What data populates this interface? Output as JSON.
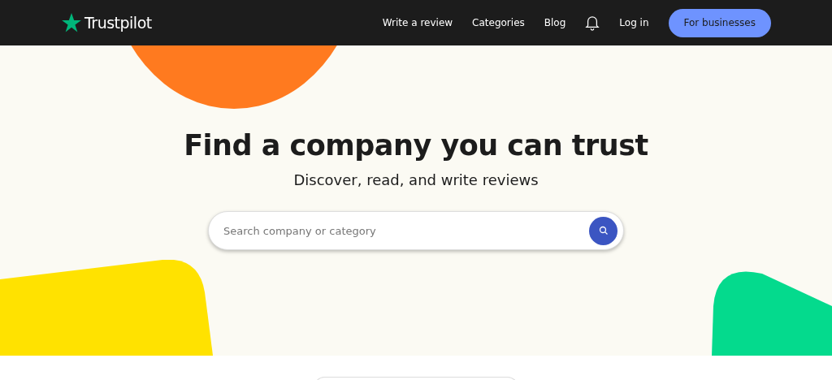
{
  "header": {
    "logo": "Trustpilot",
    "nav": [
      "Write a review",
      "Categories",
      "Blog"
    ],
    "login": "Log in",
    "cta": "For businesses"
  },
  "hero": {
    "title": "Find a company you can trust",
    "subtitle": "Discover, read, and write reviews",
    "search": {
      "placeholder": "Search company or category"
    }
  }
}
